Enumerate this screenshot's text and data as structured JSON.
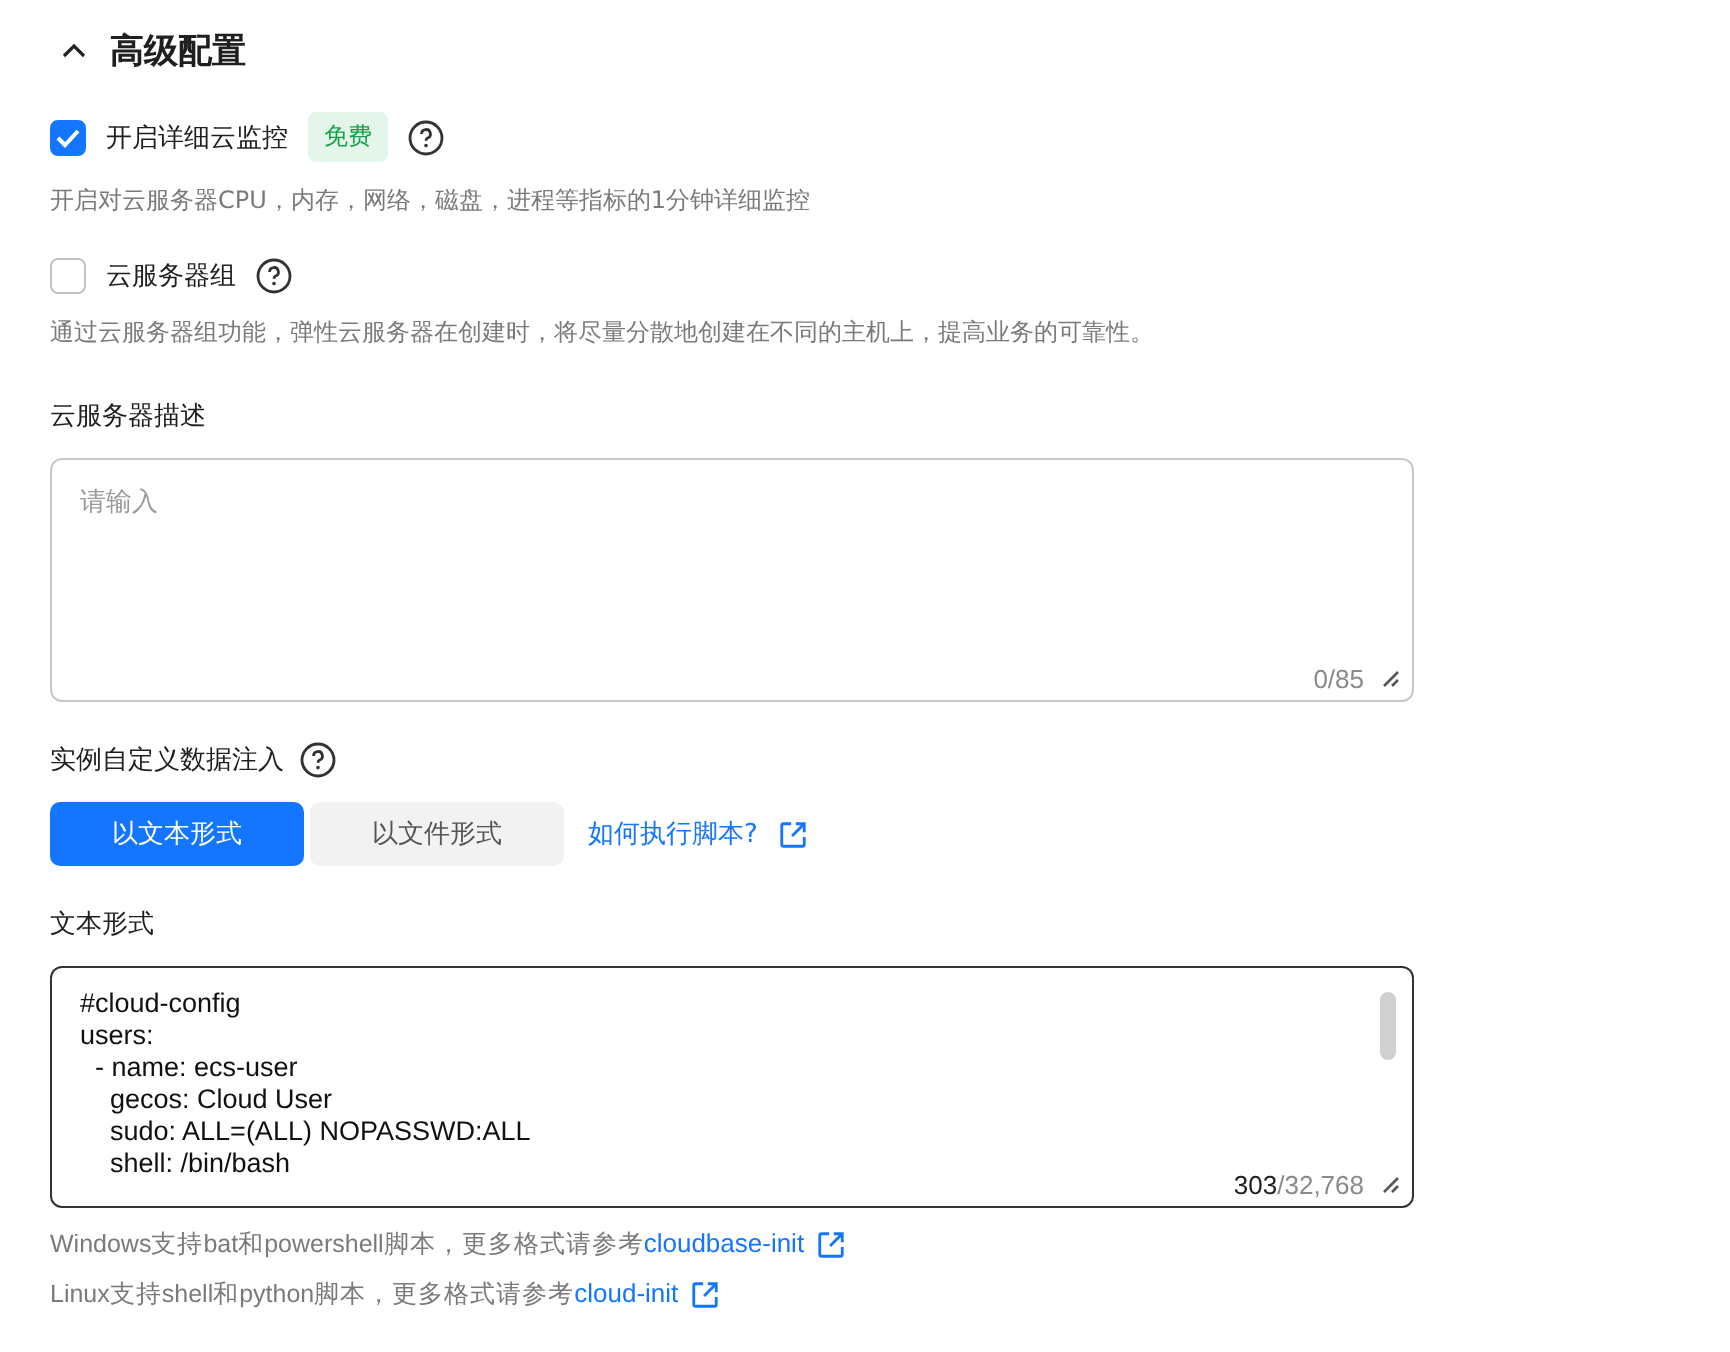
{
  "section": {
    "title": "高级配置",
    "expanded": true
  },
  "options": [
    {
      "label": "开启详细云监控",
      "checked": true,
      "badge": "免费",
      "description": "开启对云服务器CPU，内存，网络，磁盘，进程等指标的1分钟详细监控"
    },
    {
      "label": "云服务器组",
      "checked": false,
      "description": "通过云服务器组功能，弹性云服务器在创建时，将尽量分散地创建在不同的主机上，提高业务的可靠性。"
    }
  ],
  "description_field": {
    "label": "云服务器描述",
    "placeholder": "请输入",
    "counter": {
      "current": "0",
      "limit": "/85"
    }
  },
  "user_data": {
    "label": "实例自定义数据注入",
    "tabs": [
      {
        "label": "以文本形式",
        "selected": true
      },
      {
        "label": "以文件形式",
        "selected": false
      }
    ],
    "link": "如何执行脚本?"
  },
  "text_field": {
    "label": "文本形式",
    "lines": [
      "#cloud-config",
      "users:",
      "  - name: ecs-user",
      "    gecos: Cloud User",
      "    sudo: ALL=(ALL) NOPASSWD:ALL",
      "    shell: /bin/bash"
    ],
    "counter": {
      "current": "303",
      "limit": "/32,768"
    }
  },
  "help": [
    {
      "text": "Windows支持bat和powershell脚本，更多格式请参考",
      "link": "cloudbase-init"
    },
    {
      "text": "Linux支持shell和python脚本，更多格式请参考",
      "link": "cloud-init"
    }
  ]
}
